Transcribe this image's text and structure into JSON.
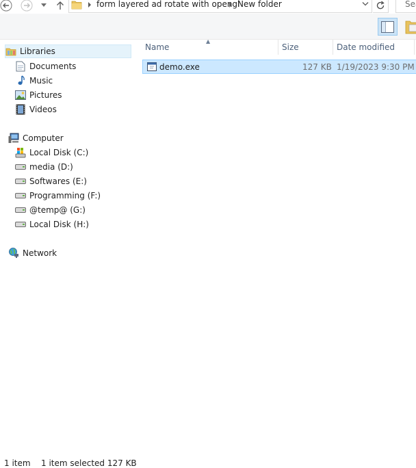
{
  "address": {
    "path": [
      "form layered ad rotate with opengl",
      "New folder"
    ]
  },
  "search": {
    "placeholder": "Sea"
  },
  "navpane": {
    "libraries": {
      "label": "Libraries",
      "items": [
        {
          "label": "Documents",
          "icon": "documents-icon"
        },
        {
          "label": "Music",
          "icon": "music-icon"
        },
        {
          "label": "Pictures",
          "icon": "pictures-icon"
        },
        {
          "label": "Videos",
          "icon": "videos-icon"
        }
      ]
    },
    "computer": {
      "label": "Computer",
      "items": [
        {
          "label": "Local Disk (C:)",
          "icon": "system-drive-icon"
        },
        {
          "label": "media (D:)",
          "icon": "drive-icon"
        },
        {
          "label": "Softwares (E:)",
          "icon": "drive-icon"
        },
        {
          "label": "Programming (F:)",
          "icon": "drive-icon"
        },
        {
          "label": "@temp@ (G:)",
          "icon": "drive-icon"
        },
        {
          "label": "Local Disk (H:)",
          "icon": "drive-icon"
        }
      ]
    },
    "network": {
      "label": "Network"
    }
  },
  "columns": {
    "name": "Name",
    "size": "Size",
    "date_modified": "Date modified"
  },
  "files": [
    {
      "name": "demo.exe",
      "size": "127 KB",
      "date_modified": "1/19/2023 9:30 PM"
    }
  ],
  "status": {
    "items": "1 item",
    "selected": "1 item selected  127 KB"
  },
  "colors": {
    "selection": "#cce8ff",
    "selection_border": "#99d1ff",
    "header_text": "#4c607a"
  }
}
